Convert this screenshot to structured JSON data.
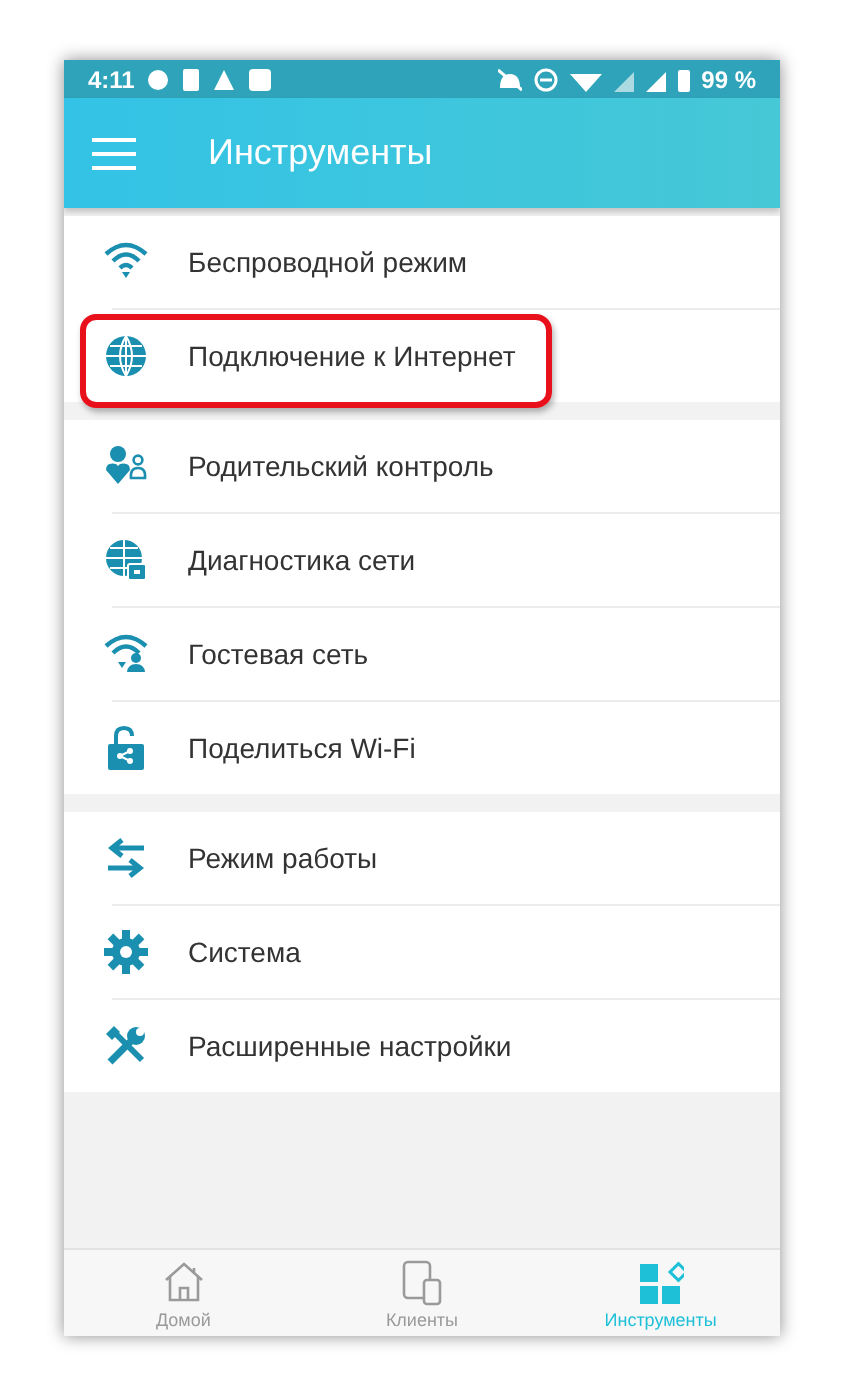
{
  "status_bar": {
    "time": "4:11",
    "battery": "99 %"
  },
  "app_bar": {
    "title": "Инструменты"
  },
  "groups": [
    {
      "items": [
        {
          "label": "Беспроводной режим",
          "highlighted": false
        },
        {
          "label": "Подключение к Интернет",
          "highlighted": true
        }
      ]
    },
    {
      "items": [
        {
          "label": "Родительский контроль",
          "highlighted": false
        },
        {
          "label": "Диагностика сети",
          "highlighted": false
        },
        {
          "label": "Гостевая сеть",
          "highlighted": false
        },
        {
          "label": "Поделиться Wi-Fi",
          "highlighted": false
        }
      ]
    },
    {
      "items": [
        {
          "label": "Режим работы",
          "highlighted": false
        },
        {
          "label": "Система",
          "highlighted": false
        },
        {
          "label": "Расширенные настройки",
          "highlighted": false
        }
      ]
    }
  ],
  "bottom_nav": [
    {
      "label": "Домой",
      "selected": false
    },
    {
      "label": "Клиенты",
      "selected": false
    },
    {
      "label": "Инструменты",
      "selected": true
    }
  ]
}
